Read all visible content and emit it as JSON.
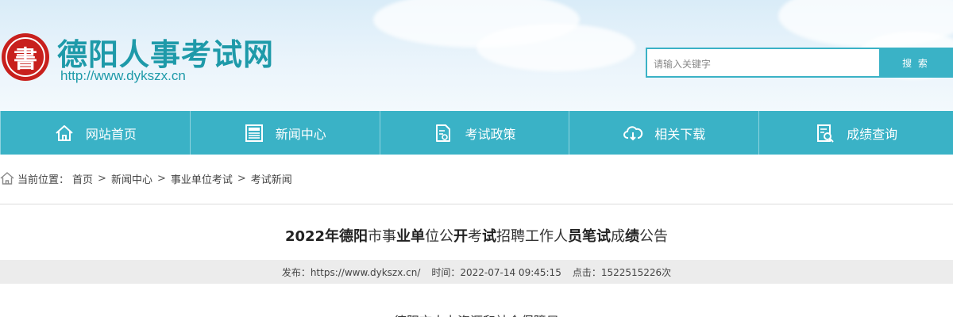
{
  "header": {
    "logo_glyph": "書",
    "site_title": "德阳人事考试网",
    "site_url": "http://www.dykszx.cn",
    "search_placeholder": "请输入关键字",
    "search_button": "搜 索"
  },
  "nav": {
    "items": [
      {
        "label": "网站首页",
        "icon": "home-icon"
      },
      {
        "label": "新闻中心",
        "icon": "news-icon"
      },
      {
        "label": "考试政策",
        "icon": "policy-document-icon"
      },
      {
        "label": "相关下载",
        "icon": "cloud-download-icon"
      },
      {
        "label": "成绩查询",
        "icon": "score-search-icon"
      }
    ]
  },
  "breadcrumb": {
    "prefix": "当前位置：",
    "items": [
      "首页",
      "新闻中心",
      "事业单位考试",
      "考试新闻"
    ],
    "separator": ">"
  },
  "article": {
    "title_parts": [
      "2022年",
      "德阳",
      "市事",
      "业单",
      "位公",
      "开",
      "考",
      "试",
      "招聘工作人",
      "员笔试",
      "成",
      "绩",
      "公告"
    ],
    "publisher": "发布：https://www.dykszx.cn/",
    "time": "时间：2022-07-14 09:45:15",
    "clicks": "点击：1522515226次",
    "body_first_line": "德阳市人力资源和社会保障局"
  },
  "colors": {
    "accent": "#3ab2c6",
    "title": "#1e9aa9",
    "seal": "#c8201d"
  }
}
